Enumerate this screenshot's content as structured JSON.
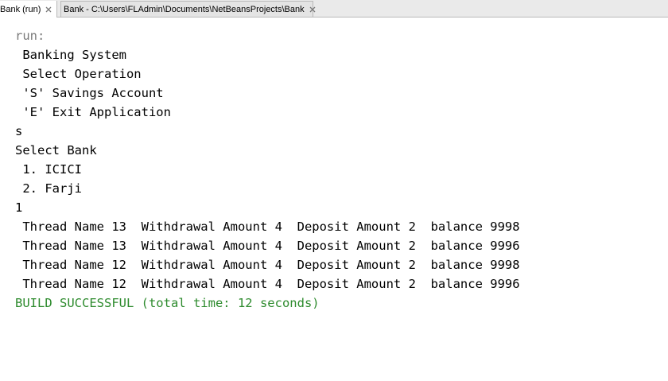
{
  "tabs": [
    {
      "label": "Bank (run)",
      "active": true
    },
    {
      "label": "Bank - C:\\Users\\FLAdmin\\Documents\\NetBeansProjects\\Bank",
      "active": false
    }
  ],
  "console": {
    "lines": [
      {
        "text": "run:",
        "kind": "run"
      },
      {
        "text": " Banking System",
        "kind": "normal"
      },
      {
        "text": " Select Operation",
        "kind": "normal"
      },
      {
        "text": " 'S' Savings Account",
        "kind": "normal"
      },
      {
        "text": " 'E' Exit Application",
        "kind": "normal"
      },
      {
        "text": "s",
        "kind": "normal"
      },
      {
        "text": "Select Bank",
        "kind": "normal"
      },
      {
        "text": " 1. ICICI",
        "kind": "normal"
      },
      {
        "text": " 2. Farji",
        "kind": "normal"
      },
      {
        "text": "1",
        "kind": "normal"
      },
      {
        "text": " Thread Name 13  Withdrawal Amount 4  Deposit Amount 2  balance 9998",
        "kind": "normal"
      },
      {
        "text": " Thread Name 13  Withdrawal Amount 4  Deposit Amount 2  balance 9996",
        "kind": "normal"
      },
      {
        "text": " Thread Name 12  Withdrawal Amount 4  Deposit Amount 2  balance 9998",
        "kind": "normal"
      },
      {
        "text": " Thread Name 12  Withdrawal Amount 4  Deposit Amount 2  balance 9996",
        "kind": "normal"
      },
      {
        "text": "BUILD SUCCESSFUL (total time: 12 seconds)",
        "kind": "success"
      }
    ]
  },
  "colors": {
    "run_text": "#7a7a7a",
    "output_text": "#000000",
    "success_text": "#2e8b2e"
  },
  "icons": {
    "tab_close": "close-icon"
  }
}
